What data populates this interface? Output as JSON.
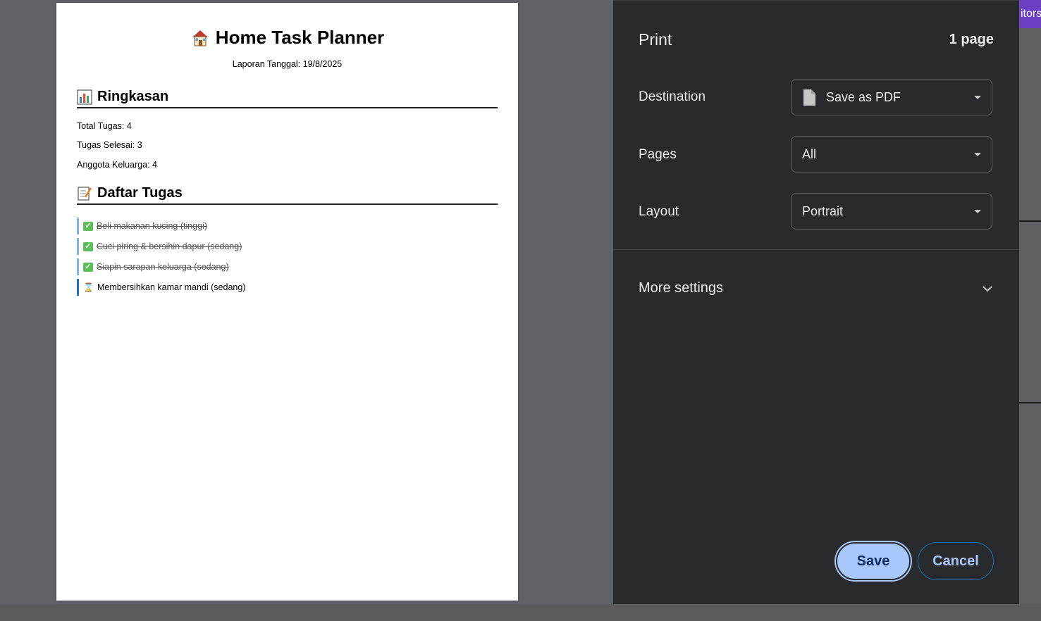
{
  "document": {
    "title": "Home Task Planner",
    "title_icon": "house-icon",
    "date_line": "Laporan Tanggal: 19/8/2025",
    "summary": {
      "heading": "Ringkasan",
      "heading_icon": "bar-chart-icon",
      "lines": [
        "Total Tugas: 4",
        "Tugas Selesai: 3",
        "Anggota Keluarga: 4"
      ]
    },
    "tasks_section": {
      "heading": "Daftar Tugas",
      "heading_icon": "memo-icon",
      "items": [
        {
          "label": "Beli makanan kucing (tinggi)",
          "done": true
        },
        {
          "label": "Cuci piring & bersihin dapur (sedang)",
          "done": true
        },
        {
          "label": "Siapin sarapan keluarga (sedang)",
          "done": true
        },
        {
          "label": "Membersihkan kamar mandi (sedang)",
          "done": false
        }
      ]
    }
  },
  "print_panel": {
    "title": "Print",
    "page_count": "1 page",
    "destination": {
      "label": "Destination",
      "value": "Save as PDF",
      "icon": "file-icon"
    },
    "pages": {
      "label": "Pages",
      "value": "All"
    },
    "layout": {
      "label": "Layout",
      "value": "Portrait"
    },
    "more_settings": "More settings",
    "save_button": "Save",
    "cancel_button": "Cancel"
  },
  "background_tab_text": "itors",
  "colors": {
    "panel_bg": "#292a2d",
    "save_accent": "#a8c7fa",
    "edge_tab": "#6a3fc1"
  }
}
